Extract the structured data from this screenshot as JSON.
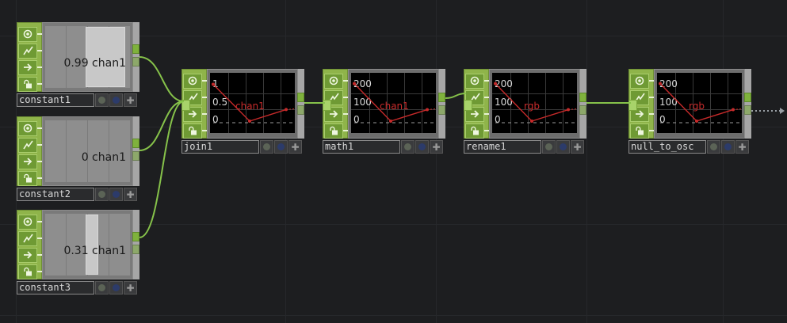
{
  "nodes": [
    {
      "id": "constant1",
      "name": "constant1",
      "type": "Constant CHOP",
      "display": "0.99 chan1",
      "value": 0.99
    },
    {
      "id": "constant2",
      "name": "constant2",
      "type": "Constant CHOP",
      "display": "0 chan1",
      "value": 0
    },
    {
      "id": "constant3",
      "name": "constant3",
      "type": "Constant CHOP",
      "display": "0.31 chan1",
      "value": 0.31
    },
    {
      "id": "join1",
      "name": "join1",
      "type": "Join CHOP",
      "y_ticks": [
        "1",
        "0.5",
        "0"
      ],
      "channel": "chan1",
      "samples": [
        0.99,
        0,
        0.31
      ]
    },
    {
      "id": "math1",
      "name": "math1",
      "type": "Math CHOP",
      "y_ticks": [
        "200",
        "100",
        "0"
      ],
      "channel": "chan1",
      "samples": [
        252,
        0,
        77
      ]
    },
    {
      "id": "rename1",
      "name": "rename1",
      "type": "Rename CHOP",
      "y_ticks": [
        "200",
        "100",
        "0"
      ],
      "channel": "rgb",
      "samples": [
        252,
        0,
        77
      ]
    },
    {
      "id": "null_to_osc",
      "name": "null_to_osc",
      "type": "Null CHOP",
      "y_ticks": [
        "200",
        "100",
        "0"
      ],
      "channel": "rgb",
      "samples": [
        252,
        0,
        77
      ]
    }
  ],
  "colors": {
    "background": "#1d1e20",
    "chop_green": "#8fb44a",
    "wire": "#86c24a",
    "graph_line": "#c72a2a"
  },
  "icons": [
    "viewer-toggle-icon",
    "cook-icon",
    "bypass-arrow-icon",
    "lock-icon",
    "display-flag-icon",
    "render-flag-icon",
    "expand-plus-icon"
  ]
}
